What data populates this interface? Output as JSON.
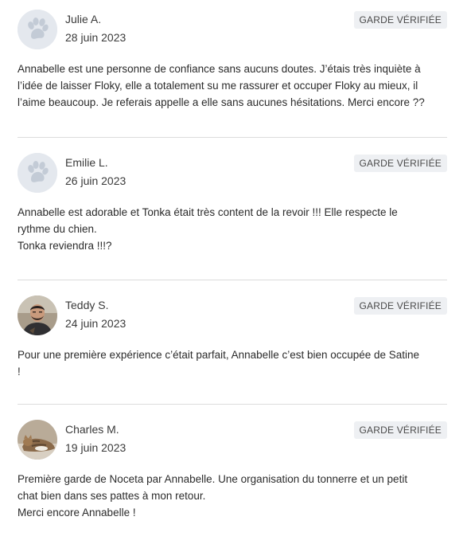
{
  "reviews": [
    {
      "name": "Julie A.",
      "date": "28 juin 2023",
      "badge": "GARDE VÉRIFIÉE",
      "avatar": "paw-icon",
      "text": "Annabelle est une personne de confiance sans aucuns doutes. J’étais très inquiète à\nl’idée de laisser Floky, elle a totalement su me rassurer et occuper Floky au mieux, il\nl’aime beaucoup. Je referais appelle a elle sans aucunes hésitations. Merci encore ??"
    },
    {
      "name": "Emilie L.",
      "date": "26 juin 2023",
      "badge": "GARDE VÉRIFIÉE",
      "avatar": "paw-icon",
      "text": "Annabelle est adorable et Tonka était très content de la revoir !!! Elle respecte le\nrythme du chien.\nTonka reviendra !!!?"
    },
    {
      "name": "Teddy S.",
      "date": "24 juin 2023",
      "badge": "GARDE VÉRIFIÉE",
      "avatar": "user-photo",
      "text": "Pour une première expérience c’était parfait, Annabelle c’est bien occupée de Satine\n!"
    },
    {
      "name": "Charles M.",
      "date": "19 juin 2023",
      "badge": "GARDE VÉRIFIÉE",
      "avatar": "cat-photo",
      "text": "Première garde de Noceta par Annabelle. Une organisation du tonnerre et un petit\nchat bien dans ses pattes à mon retour.\nMerci encore Annabelle !"
    }
  ],
  "colors": {
    "badge_bg": "#eef0f3",
    "separator": "#dcdcdc",
    "avatar_placeholder": "#e4e8ee",
    "paw": "#c3cbd6"
  }
}
